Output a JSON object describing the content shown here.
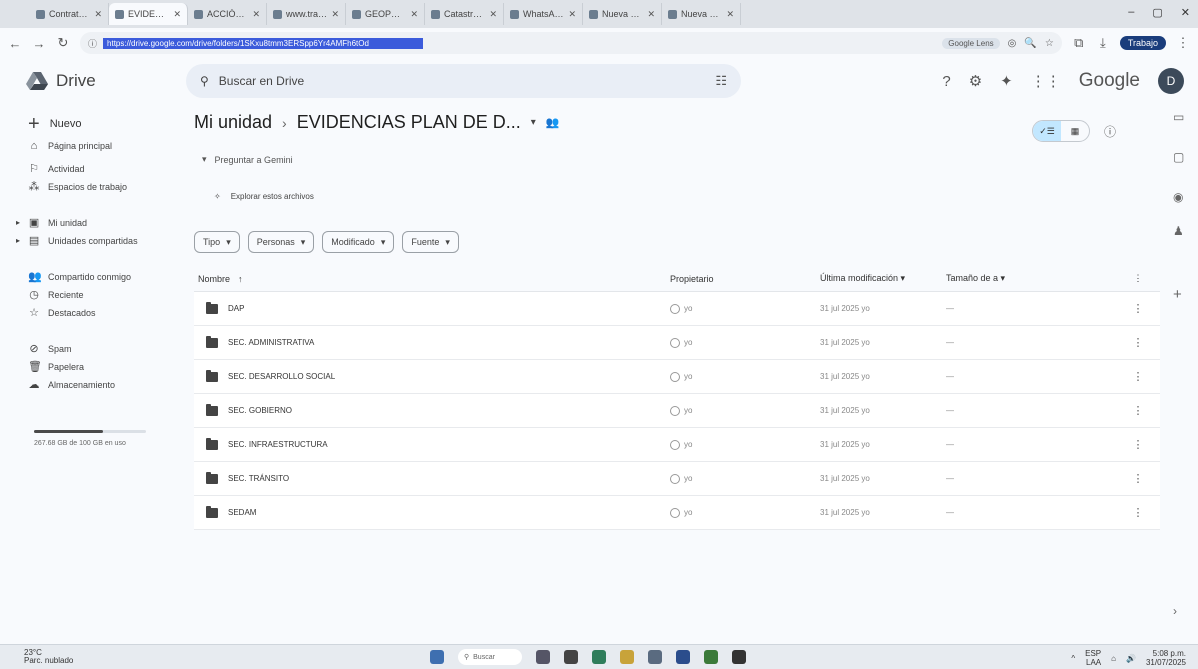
{
  "browser": {
    "tabs": [
      {
        "label": "Contratación de...",
        "active": false
      },
      {
        "label": "EVIDENCIAS PLAN D...",
        "active": true
      },
      {
        "label": "ACCIÓN CONTRA...",
        "active": false
      },
      {
        "label": "www.transparencia...",
        "active": false
      },
      {
        "label": "GEOPORTAL Portal...",
        "active": false
      },
      {
        "label": "Catastro - Consulta",
        "active": false
      },
      {
        "label": "WhatsApp",
        "active": false
      },
      {
        "label": "Nueva pestaña",
        "active": false
      },
      {
        "label": "Nueva pestaña",
        "active": false
      }
    ],
    "url": "https://drive.google.com/drive/folders/1SKxu8tmm3ERSpp6Yr4AMFh6tOd",
    "search_engine": "Google Lens",
    "profile_label": "Trabajo"
  },
  "drive": {
    "product_name": "Drive",
    "search_placeholder": "Buscar en Drive",
    "brand_word": "Google",
    "avatar_letter": "D"
  },
  "sidebar": {
    "new_label": "Nuevo",
    "items": [
      {
        "label": "Página principal",
        "icon": "home-icon",
        "glyph": "⌂"
      },
      {
        "label": "Actividad",
        "icon": "activity-icon",
        "glyph": "⚐"
      },
      {
        "label": "Espacios de trabajo",
        "icon": "workspaces-icon",
        "glyph": "⁂"
      },
      {
        "label": "Mi unidad",
        "icon": "my-drive-icon",
        "glyph": "▣"
      },
      {
        "label": "Unidades compartidas",
        "icon": "shared-drives-icon",
        "glyph": "▤"
      },
      {
        "label": "Compartido conmigo",
        "icon": "shared-with-me-icon",
        "glyph": "👥"
      },
      {
        "label": "Reciente",
        "icon": "recent-icon",
        "glyph": "◷"
      },
      {
        "label": "Destacados",
        "icon": "starred-icon",
        "glyph": "☆"
      },
      {
        "label": "Spam",
        "icon": "spam-icon",
        "glyph": "⊘"
      },
      {
        "label": "Papelera",
        "icon": "trash-icon",
        "glyph": "🗑"
      },
      {
        "label": "Almacenamiento",
        "icon": "cloud-icon",
        "glyph": "☁"
      }
    ],
    "storage_used_fraction": 0.62,
    "storage_text": "267.68 GB de 100 GB en uso"
  },
  "main": {
    "breadcrumb_root": "Mi unidad",
    "breadcrumb_current": "EVIDENCIAS PLAN DE D...",
    "gemini_label": "Preguntar a Gemini",
    "explore_label": "Explorar estos archivos",
    "filters": [
      "Tipo",
      "Personas",
      "Modificado",
      "Fuente"
    ],
    "columns": {
      "name": "Nombre",
      "owner": "Propietario",
      "modified": "Última modificación",
      "size": "Tamaño de a"
    },
    "rows": [
      {
        "name": "DAP",
        "owner": "yo",
        "modified": "31 jul 2025 yo",
        "size": "—"
      },
      {
        "name": "SEC. ADMINISTRATIVA",
        "owner": "yo",
        "modified": "31 jul 2025 yo",
        "size": "—"
      },
      {
        "name": "SEC. DESARROLLO SOCIAL",
        "owner": "yo",
        "modified": "31 jul 2025 yo",
        "size": "—"
      },
      {
        "name": "SEC. GOBIERNO",
        "owner": "yo",
        "modified": "31 jul 2025 yo",
        "size": "—"
      },
      {
        "name": "SEC. INFRAESTRUCTURA",
        "owner": "yo",
        "modified": "31 jul 2025 yo",
        "size": "—"
      },
      {
        "name": "SEC. TRÁNSITO",
        "owner": "yo",
        "modified": "31 jul 2025 yo",
        "size": "—"
      },
      {
        "name": "SEDAM",
        "owner": "yo",
        "modified": "31 jul 2025 yo",
        "size": "—"
      }
    ]
  },
  "taskbar": {
    "weather_temp": "23°C",
    "weather_desc": "Parc. nublado",
    "search_label": "Buscar",
    "lang_top": "ESP",
    "lang_bottom": "LAA",
    "time": "5:08 p.m.",
    "date": "31/07/2025"
  }
}
